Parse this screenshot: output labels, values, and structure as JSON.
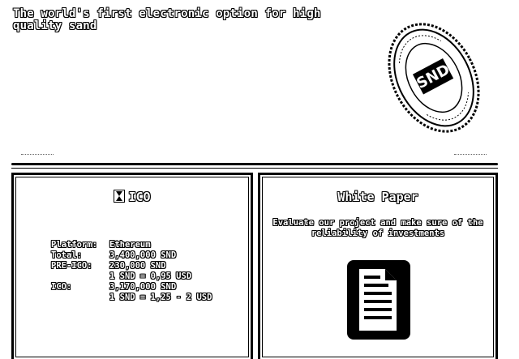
{
  "header": {
    "tagline": "The world's first electronic option for high quality sand"
  },
  "seal": {
    "brand": "SND",
    "ring_text": "SAND TOKEN • WWW.ELECTRONIC-SAND.COM"
  },
  "ico_panel": {
    "title": "ICO",
    "icon": "hourglass-icon",
    "rows": [
      {
        "label": "Platform:",
        "value": "Ethereum"
      },
      {
        "label": "Total:",
        "value": "3,400,000 SND"
      },
      {
        "label": "PRE-ICO:",
        "value": "230,000 SND"
      },
      {
        "label": "",
        "value": "1 SND = 0,95 USD"
      },
      {
        "label": "ICO:",
        "value": "3,170,000 SND"
      },
      {
        "label": "",
        "value": "1 SND = 1,25 - 2 USD"
      }
    ]
  },
  "whitepaper_panel": {
    "title": "White Paper",
    "description": "Evaluate our project and make sure of the reliability of investments",
    "icon": "document-icon"
  }
}
